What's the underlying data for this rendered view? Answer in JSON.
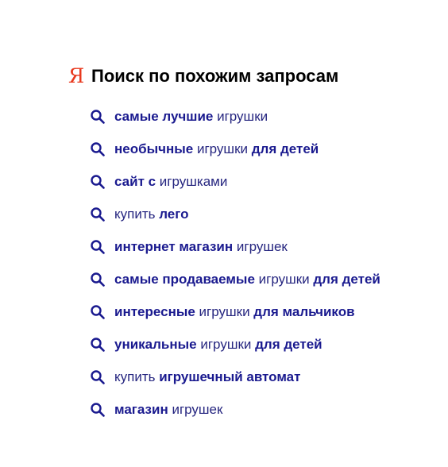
{
  "header": {
    "logo_letter": "Я",
    "title": "Поиск по похожим запросам"
  },
  "colors": {
    "logo": "#e8391e",
    "link": "#1a1a8f",
    "title": "#000000",
    "icon": "#1a1a8f"
  },
  "icons": {
    "logo": "yandex-logo-icon",
    "item": "search-icon"
  },
  "queries": [
    [
      {
        "t": "самые лучшие",
        "b": true
      },
      {
        "t": " игрушки",
        "b": false
      }
    ],
    [
      {
        "t": "необычные",
        "b": true
      },
      {
        "t": " игрушки ",
        "b": false
      },
      {
        "t": "для детей",
        "b": true
      }
    ],
    [
      {
        "t": "сайт с",
        "b": true
      },
      {
        "t": " игрушками",
        "b": false
      }
    ],
    [
      {
        "t": "купить ",
        "b": false
      },
      {
        "t": "лего",
        "b": true
      }
    ],
    [
      {
        "t": "интернет магазин",
        "b": true
      },
      {
        "t": " игрушек",
        "b": false
      }
    ],
    [
      {
        "t": "самые продаваемые",
        "b": true
      },
      {
        "t": " игрушки ",
        "b": false
      },
      {
        "t": "для детей",
        "b": true
      }
    ],
    [
      {
        "t": "интересные",
        "b": true
      },
      {
        "t": " игрушки ",
        "b": false
      },
      {
        "t": "для мальчиков",
        "b": true
      }
    ],
    [
      {
        "t": "уникальные",
        "b": true
      },
      {
        "t": " игрушки ",
        "b": false
      },
      {
        "t": "для детей",
        "b": true
      }
    ],
    [
      {
        "t": "купить ",
        "b": false
      },
      {
        "t": "игрушечный автомат",
        "b": true
      }
    ],
    [
      {
        "t": "магазин",
        "b": true
      },
      {
        "t": " игрушек",
        "b": false
      }
    ]
  ]
}
